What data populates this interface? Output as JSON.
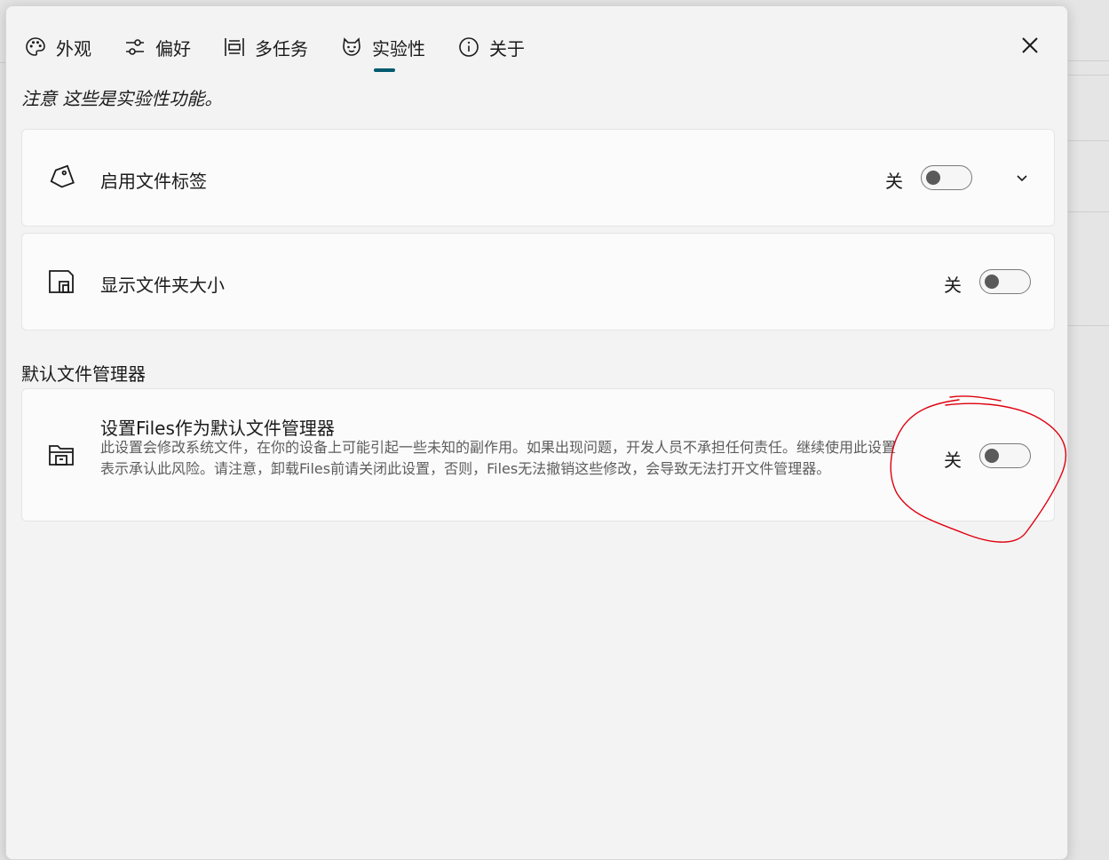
{
  "tabs": [
    {
      "label": "外观",
      "icon": "palette-icon"
    },
    {
      "label": "偏好",
      "icon": "sliders-icon"
    },
    {
      "label": "多任务",
      "icon": "multitask-icon"
    },
    {
      "label": "实验性",
      "icon": "experimental-icon",
      "active": true
    },
    {
      "label": "关于",
      "icon": "info-icon"
    }
  ],
  "note": "注意 这些是实验性功能。",
  "settings": {
    "file_tags": {
      "title": "启用文件标签",
      "state": "关",
      "icon": "tag-icon",
      "toggle_on": false
    },
    "folder_size": {
      "title": "显示文件夹大小",
      "state": "关",
      "icon": "folder-size-icon",
      "toggle_on": false
    }
  },
  "default_section": {
    "heading": "默认文件管理器",
    "title": "设置Files作为默认文件管理器",
    "description": "此设置会修改系统文件，在你的设备上可能引起一些未知的副作用。如果出现问题，开发人员不承担任何责任。继续使用此设置表示承认此风险。请注意，卸载Files前请关闭此设置，否则，Files无法撤销这些修改，会导致无法打开文件管理器。",
    "state": "关",
    "icon": "file-manager-icon",
    "toggle_on": false
  },
  "colors": {
    "accent": "#005a70",
    "annotation": "#e0000f"
  }
}
